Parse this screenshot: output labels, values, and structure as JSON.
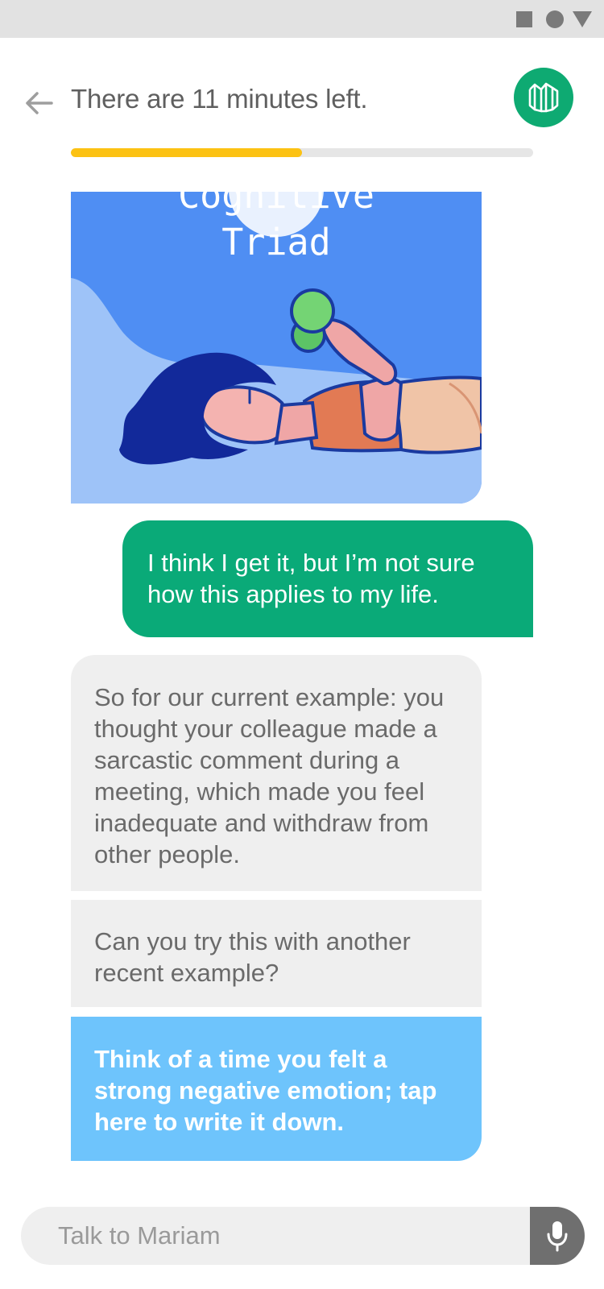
{
  "status_bar": {
    "icons": [
      "square-icon",
      "circle-icon",
      "triangle-icon"
    ]
  },
  "header": {
    "back_icon": "arrow-left-icon",
    "title": "There are 11 minutes left.",
    "avatar_icon": "brain-logo-icon",
    "progress_fraction": 0.5,
    "progress_color": "#fcc213"
  },
  "video": {
    "title_line1": "Cognitive",
    "title_line2": "Triad",
    "play_icon": "play-button-icon"
  },
  "messages": {
    "user": "I think I get it, but I’m not sure how this applies to my life.",
    "bot_1": "So for our current example: you thought your colleague made a sarcastic comment during a meeting, which made you feel inadequate and withdraw from other people.",
    "bot_2": "Can you try this with another recent example?",
    "action": "Think of a time you felt a strong negative emotion; tap here to write it down."
  },
  "input": {
    "placeholder": "Talk to Mariam",
    "mic_icon": "microphone-icon"
  },
  "colors": {
    "brand_green": "#0eaa72",
    "user_bubble": "#0aaa78",
    "bot_bubble": "#efefef",
    "action_bubble": "#6ec4fc",
    "video_bg": "#4f8ef3"
  }
}
